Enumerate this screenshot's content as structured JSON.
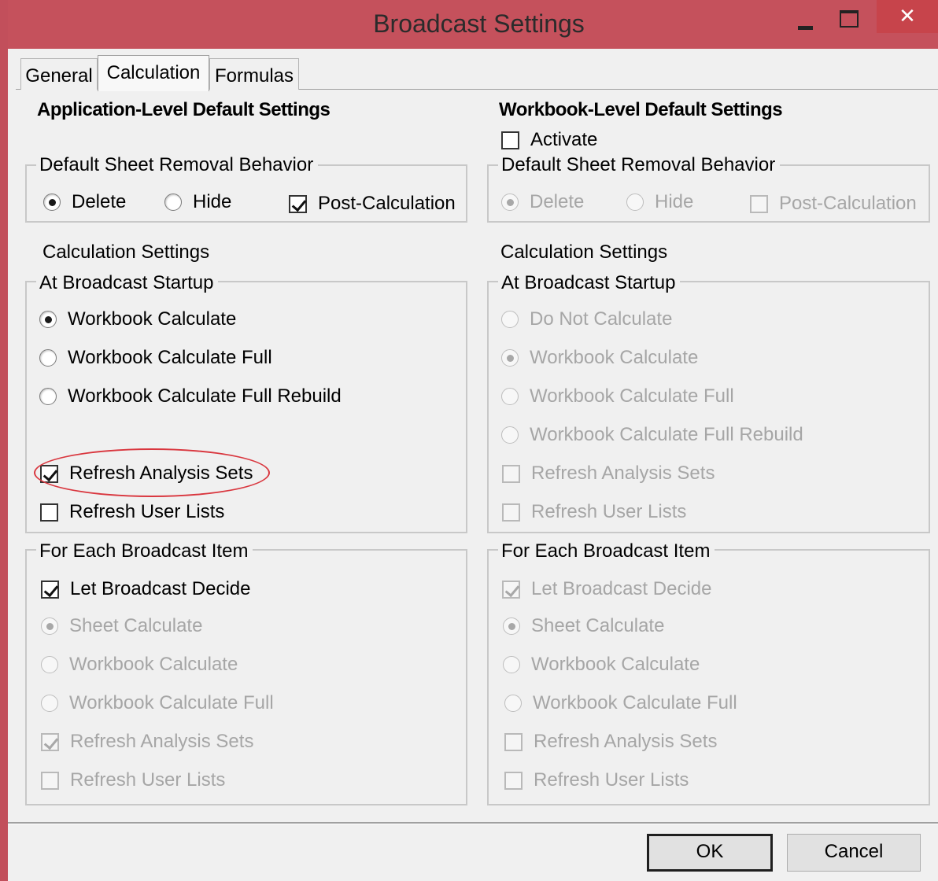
{
  "window": {
    "title": "Broadcast Settings",
    "close_glyph": "✕",
    "accent": "#c5515c"
  },
  "tabs": [
    {
      "label": "General",
      "active": false
    },
    {
      "label": "Calculation",
      "active": true
    },
    {
      "label": "Formulas",
      "active": false
    }
  ],
  "app": {
    "heading": "Application-Level Default Settings",
    "removal": {
      "legend": "Default Sheet Removal Behavior",
      "delete": "Delete",
      "hide": "Hide",
      "post_calc": "Post-Calculation"
    },
    "calc_settings": "Calculation Settings",
    "startup": {
      "legend": "At Broadcast Startup",
      "workbook_calc": "Workbook Calculate",
      "workbook_calc_full": "Workbook Calculate Full",
      "workbook_calc_full_rebuild": "Workbook Calculate Full Rebuild",
      "refresh_analysis": "Refresh Analysis Sets",
      "refresh_user_lists": "Refresh User Lists"
    },
    "each_item": {
      "legend": "For Each Broadcast Item",
      "let_decide": "Let Broadcast Decide",
      "sheet_calc": "Sheet Calculate",
      "workbook_calc": "Workbook Calculate",
      "workbook_calc_full": "Workbook Calculate Full",
      "refresh_analysis": "Refresh Analysis Sets",
      "refresh_user_lists": "Refresh User Lists"
    }
  },
  "workbook": {
    "heading": "Workbook-Level Default Settings",
    "activate": "Activate",
    "removal": {
      "legend": "Default Sheet Removal Behavior",
      "delete": "Delete",
      "hide": "Hide",
      "post_calc": "Post-Calculation"
    },
    "calc_settings": "Calculation Settings",
    "startup": {
      "legend": "At Broadcast Startup",
      "do_not_calc": "Do Not Calculate",
      "workbook_calc": "Workbook Calculate",
      "workbook_calc_full": "Workbook Calculate Full",
      "workbook_calc_full_rebuild": "Workbook Calculate Full Rebuild",
      "refresh_analysis": "Refresh Analysis Sets",
      "refresh_user_lists": "Refresh User Lists"
    },
    "each_item": {
      "legend": "For Each Broadcast Item",
      "let_decide": "Let Broadcast Decide",
      "sheet_calc": "Sheet Calculate",
      "workbook_calc": "Workbook Calculate",
      "workbook_calc_full": "Workbook Calculate Full",
      "refresh_analysis": "Refresh Analysis Sets",
      "refresh_user_lists": "Refresh User Lists"
    }
  },
  "buttons": {
    "ok": "OK",
    "cancel": "Cancel"
  }
}
